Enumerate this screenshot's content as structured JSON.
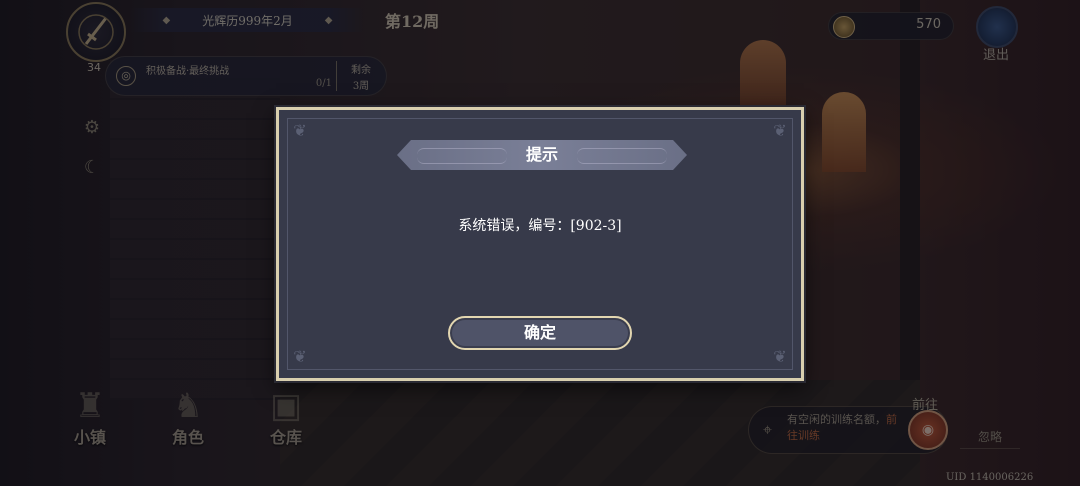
{
  "hud": {
    "level": "34",
    "date": "光辉历999年2月",
    "week": "第12周",
    "task": {
      "title": "积极备战·最终挑战",
      "progress": "0/1",
      "remain_label": "剩余",
      "remain_value": "3周"
    },
    "coins": "570",
    "exit_label": "退出"
  },
  "nav": {
    "items": [
      {
        "label": "小镇",
        "icon": "castle-icon"
      },
      {
        "label": "角色",
        "icon": "helmet-icon"
      },
      {
        "label": "仓库",
        "icon": "chest-icon"
      }
    ]
  },
  "training": {
    "text": "有空闲的训练名额，",
    "link": "前往训练",
    "goto_label": "前往",
    "ignore_label": "忽略"
  },
  "uid": "UID 1140006226",
  "dialog": {
    "title": "提示",
    "message": "系统错误，编号：[902-3]",
    "confirm_label": "确定"
  },
  "colors": {
    "dialog_bg": "#373a4a",
    "dialog_border": "#d9cfae",
    "title_bar": "#72778f",
    "accent_link": "#c46a3d"
  }
}
